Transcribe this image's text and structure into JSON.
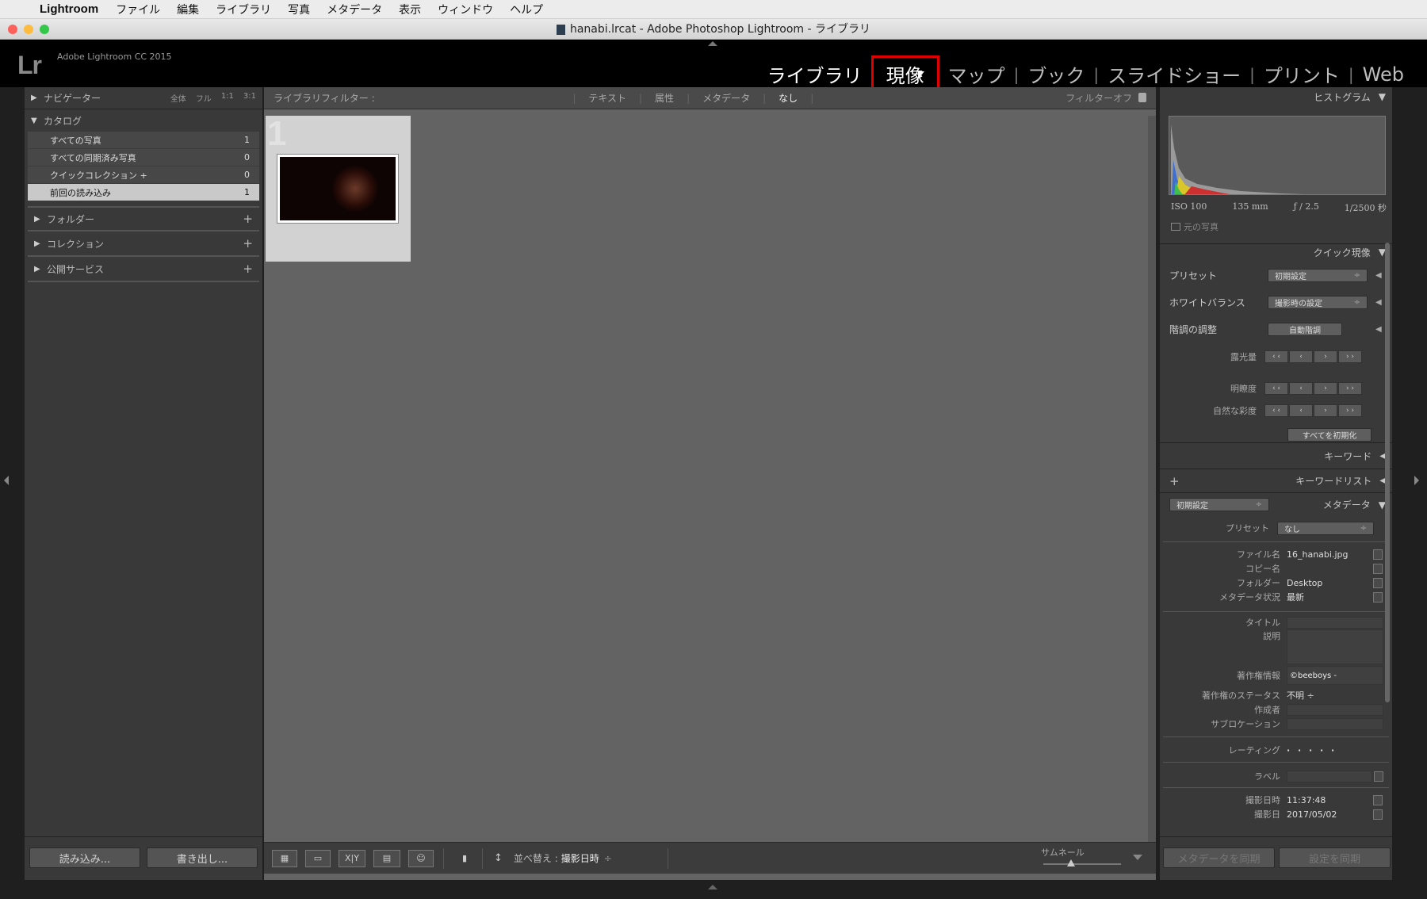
{
  "menubar": {
    "app": "Lightroom",
    "items": [
      "ファイル",
      "編集",
      "ライブラリ",
      "写真",
      "メタデータ",
      "表示",
      "ウィンドウ",
      "ヘルプ"
    ]
  },
  "window": {
    "title": "hanabi.lrcat - Adobe Photoshop Lightroom - ライブラリ"
  },
  "header": {
    "logo": "Lr",
    "version": "Adobe Lightroom CC 2015",
    "modules": [
      {
        "label": "ライブラリ"
      },
      {
        "label": "現像"
      },
      {
        "label": "マップ"
      },
      {
        "label": "ブック"
      },
      {
        "label": "スライドショー"
      },
      {
        "label": "プリント"
      },
      {
        "label": "Web"
      }
    ],
    "highlight_color": "#e00000"
  },
  "left": {
    "navigator": {
      "label": "ナビゲーター",
      "opts": [
        "全体",
        "フル",
        "1:1",
        "3:1"
      ]
    },
    "catalog": {
      "label": "カタログ",
      "items": [
        {
          "label": "すべての写真",
          "count": "1"
        },
        {
          "label": "すべての同期済み写真",
          "count": "0"
        },
        {
          "label": "クイックコレクション +",
          "count": "0"
        },
        {
          "label": "前回の読み込み",
          "count": "1"
        }
      ]
    },
    "folders": "フォルダー",
    "collections": "コレクション",
    "publish": "公開サービス",
    "import_btn": "読み込み...",
    "export_btn": "書き出し..."
  },
  "filterbar": {
    "label": "ライブラリフィルター :",
    "opts": [
      "テキスト",
      "属性",
      "メタデータ",
      "なし"
    ],
    "right": "フィルターオフ"
  },
  "grid": {
    "index": "1"
  },
  "toolbar": {
    "sort_label": "並べ替え :",
    "sort_value": "撮影日時",
    "thumb_label": "サムネール",
    "compare_label": "X|Y"
  },
  "right": {
    "histogram": {
      "label": "ヒストグラム",
      "iso": "ISO 100",
      "focal": "135 mm",
      "aperture": "ƒ / 2.5",
      "shutter": "1/2500 秒",
      "original": "元の写真"
    },
    "quick": {
      "label": "クイック現像",
      "preset_label": "プリセット",
      "preset_value": "初期設定",
      "wb_label": "ホワイトバランス",
      "wb_value": "撮影時の設定",
      "tone_label": "階調の調整",
      "auto_tone": "自動階調",
      "exposure": "露光量",
      "clarity": "明瞭度",
      "vibrance": "自然な彩度",
      "reset_all": "すべてを初期化"
    },
    "keyword": "キーワード",
    "keyword_list": "キーワードリスト",
    "metadata": {
      "preset_dd": "初期設定",
      "label": "メタデータ",
      "preset_label": "プリセット",
      "preset_value": "なし",
      "rows": [
        {
          "label": "ファイル名",
          "value": "16_hanabi.jpg"
        },
        {
          "label": "コピー名",
          "value": ""
        },
        {
          "label": "フォルダー",
          "value": "Desktop"
        },
        {
          "label": "メタデータ状況",
          "value": "最新"
        },
        {
          "label": "タイトル",
          "value": ""
        },
        {
          "label": "説明",
          "value": ""
        },
        {
          "label": "著作権情報",
          "value": "©beeboys -"
        },
        {
          "label": "著作権のステータス",
          "value": "不明 ÷"
        },
        {
          "label": "作成者",
          "value": ""
        },
        {
          "label": "サブロケーション",
          "value": ""
        },
        {
          "label": "レーティング",
          "value": "· · · · ·"
        },
        {
          "label": "ラベル",
          "value": ""
        },
        {
          "label": "撮影日時",
          "value": "11:37:48"
        },
        {
          "label": "撮影日",
          "value": "2017/05/02"
        }
      ]
    },
    "sync_meta": "メタデータを同期",
    "sync_settings": "設定を同期"
  }
}
